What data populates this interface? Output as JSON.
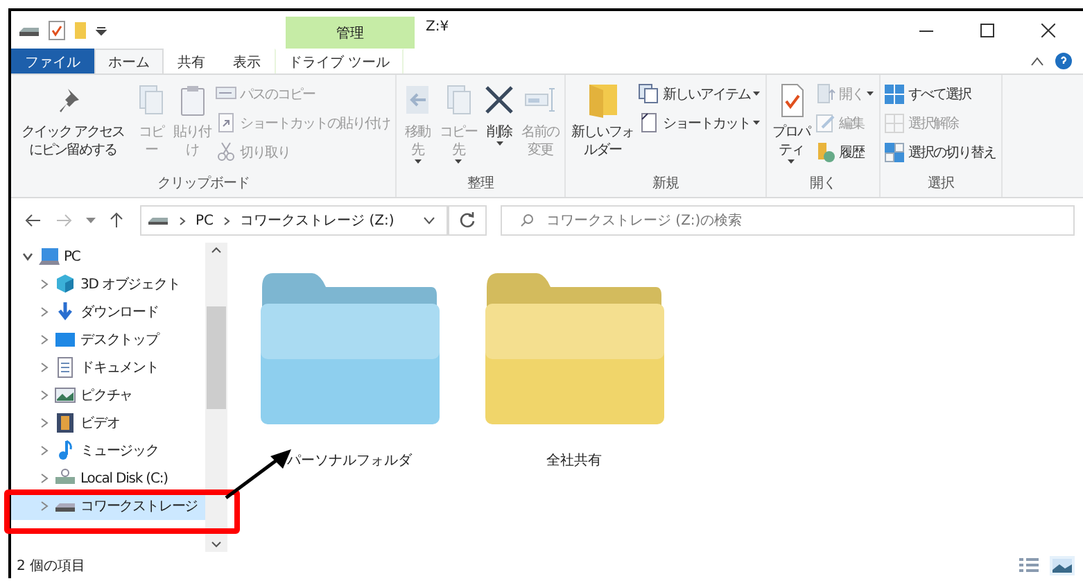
{
  "title_bar": {
    "context_label": "管理",
    "title": "Z:¥"
  },
  "tabs": [
    {
      "label": "ファイル",
      "kind": "file",
      "selected": false
    },
    {
      "label": "ホーム",
      "kind": "normal",
      "selected": true
    },
    {
      "label": "共有",
      "kind": "normal",
      "selected": false
    },
    {
      "label": "表示",
      "kind": "normal",
      "selected": false
    },
    {
      "label": "ドライブ ツール",
      "kind": "context",
      "selected": false
    }
  ],
  "ribbon": {
    "groups": [
      {
        "label": "クリップボード",
        "items": [
          {
            "label": "クイック アクセスにピン留めする",
            "kind": "large",
            "disabled": false,
            "menu": false
          },
          {
            "label": "コピー",
            "kind": "large",
            "disabled": true,
            "menu": false
          },
          {
            "label": "貼り付け",
            "kind": "large",
            "disabled": true,
            "menu": false
          },
          {
            "label": "パスのコピー",
            "kind": "small",
            "disabled": true,
            "menu": false
          },
          {
            "label": "ショートカットの貼り付け",
            "kind": "small",
            "disabled": true,
            "menu": false
          },
          {
            "label": "切り取り",
            "kind": "small",
            "disabled": true,
            "menu": false
          }
        ]
      },
      {
        "label": "整理",
        "items": [
          {
            "label": "移動先",
            "kind": "large",
            "disabled": true,
            "menu": true
          },
          {
            "label": "コピー先",
            "kind": "large",
            "disabled": true,
            "menu": true
          },
          {
            "label": "削除",
            "kind": "large",
            "disabled": false,
            "menu": true
          },
          {
            "label": "名前の変更",
            "kind": "large",
            "disabled": true,
            "menu": false
          }
        ]
      },
      {
        "label": "新規",
        "items": [
          {
            "label": "新しいフォルダー",
            "kind": "large",
            "disabled": false,
            "menu": false
          },
          {
            "label": "新しいアイテム",
            "kind": "small",
            "disabled": false,
            "menu": true
          },
          {
            "label": "ショートカット",
            "kind": "small",
            "disabled": false,
            "menu": true
          }
        ]
      },
      {
        "label": "開く",
        "items": [
          {
            "label": "プロパティ",
            "kind": "large",
            "disabled": false,
            "menu": true
          },
          {
            "label": "開く",
            "kind": "small",
            "disabled": true,
            "menu": true
          },
          {
            "label": "編集",
            "kind": "small",
            "disabled": true,
            "menu": false
          },
          {
            "label": "履歴",
            "kind": "small",
            "disabled": false,
            "menu": false
          }
        ]
      },
      {
        "label": "選択",
        "items": [
          {
            "label": "すべて選択",
            "kind": "small",
            "disabled": false,
            "menu": false
          },
          {
            "label": "選択解除",
            "kind": "small",
            "disabled": true,
            "menu": false
          },
          {
            "label": "選択の切り替え",
            "kind": "small",
            "disabled": false,
            "menu": false
          }
        ]
      }
    ]
  },
  "address_bar": {
    "path": [
      "PC",
      "コワークストレージ (Z:)"
    ]
  },
  "search": {
    "placeholder": "コワークストレージ (Z:)の検索"
  },
  "sidebar": {
    "items": [
      {
        "label": "PC",
        "expanded": true,
        "selected": false,
        "highlighted": false,
        "children": [
          {
            "label": "3D オブジェクト",
            "expanded": false,
            "selected": false,
            "highlighted": false
          },
          {
            "label": "ダウンロード",
            "expanded": false,
            "selected": false,
            "highlighted": false
          },
          {
            "label": "デスクトップ",
            "expanded": false,
            "selected": false,
            "highlighted": false
          },
          {
            "label": "ドキュメント",
            "expanded": false,
            "selected": false,
            "highlighted": false
          },
          {
            "label": "ピクチャ",
            "expanded": false,
            "selected": false,
            "highlighted": false
          },
          {
            "label": "ビデオ",
            "expanded": false,
            "selected": false,
            "highlighted": false
          },
          {
            "label": "ミュージック",
            "expanded": false,
            "selected": false,
            "highlighted": false
          },
          {
            "label": "Local Disk (C:)",
            "expanded": false,
            "selected": false,
            "highlighted": false
          },
          {
            "label": "コワークストレージ",
            "expanded": false,
            "selected": true,
            "highlighted": true
          }
        ]
      }
    ]
  },
  "files": [
    {
      "name": "パーソナルフォルダ",
      "color": "#8ecfee",
      "selected": false
    },
    {
      "name": "全社共有",
      "color": "#f0d56a",
      "selected": false
    }
  ],
  "status_bar": {
    "text": "2 個の項目",
    "views": [
      {
        "kind": "details",
        "selected": false
      },
      {
        "kind": "large_icons",
        "selected": true
      }
    ]
  }
}
